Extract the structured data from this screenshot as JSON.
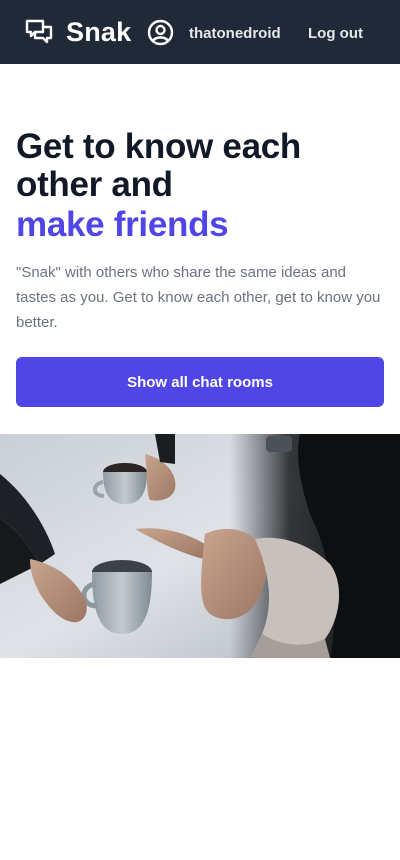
{
  "nav": {
    "brand_icon": "chat-bubbles-icon",
    "brand_name": "Snak",
    "user_icon": "user-circle-icon",
    "username": "thatonedroid",
    "logout_label": "Log out"
  },
  "hero": {
    "headline_line1": "Get to know each other and",
    "headline_accent": "make friends",
    "lead": "\"Snak\" with others who share the same ideas and tastes as you. Get to know each other, get to know you better.",
    "cta_label": "Show all chat rooms"
  },
  "photo": {
    "subject": "hands-and-coffee-cups-photo"
  },
  "colors": {
    "nav_bg": "#1f2937",
    "accent": "#4f46e5",
    "text_muted": "#6b7280"
  }
}
